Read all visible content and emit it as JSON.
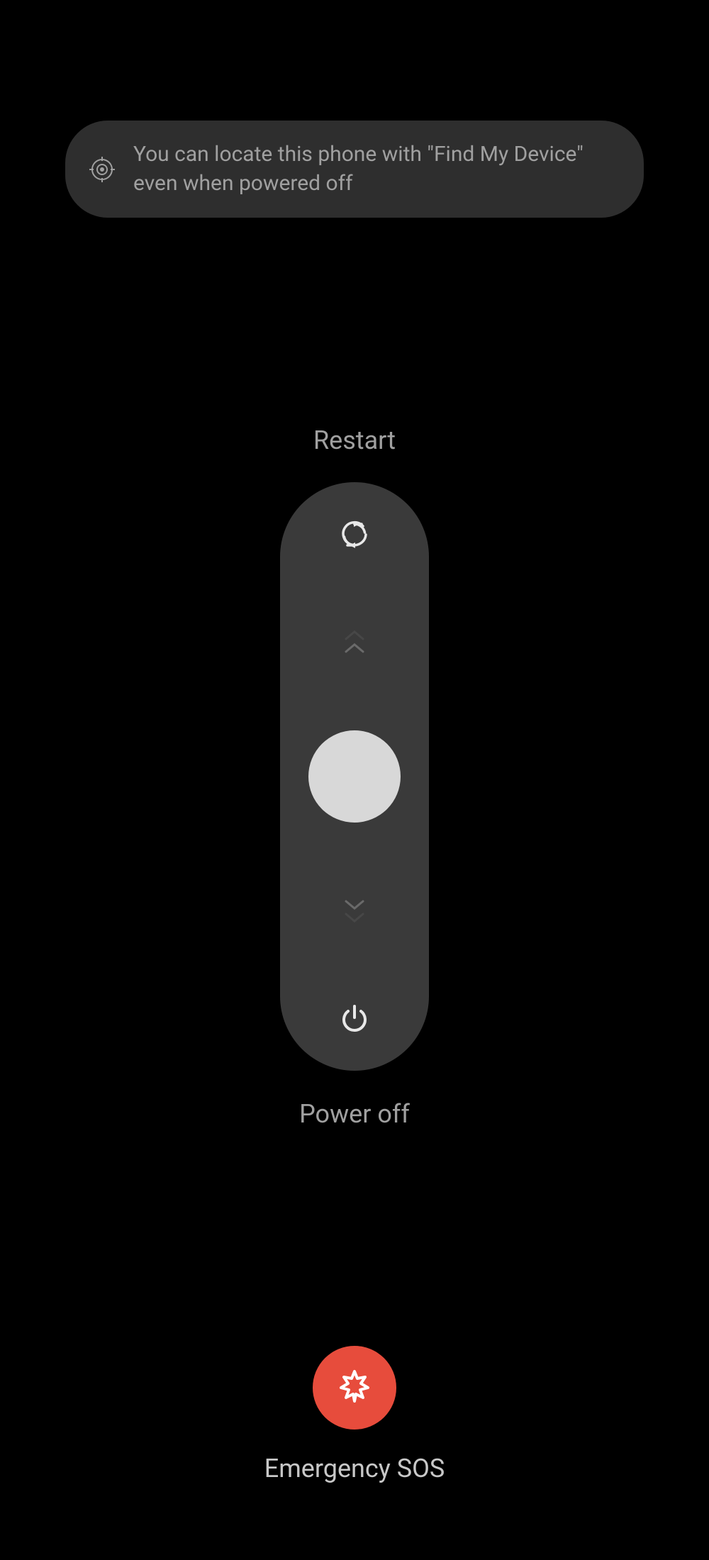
{
  "banner": {
    "text": "You can locate this phone with \"Find My Device\" even when powered off"
  },
  "controls": {
    "restart_label": "Restart",
    "poweroff_label": "Power off"
  },
  "sos": {
    "label": "Emergency SOS"
  },
  "colors": {
    "sos_button": "#e74c3c",
    "track": "#3a3a3a",
    "thumb": "#d8d8d8"
  }
}
